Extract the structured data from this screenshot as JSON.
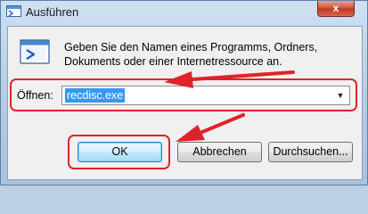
{
  "window": {
    "title": "Ausführen",
    "close_label": "x",
    "title_icon": "run-dialog-icon"
  },
  "dialog": {
    "description": "Geben Sie den Namen eines Programms, Ordners, Dokuments oder einer Internetressource an.",
    "big_icon": "run-dialog-icon",
    "open_label": "Öffnen:",
    "input_value": "recdisc.exe",
    "dropdown_icon": "chevron-down-icon"
  },
  "buttons": {
    "ok": "OK",
    "cancel": "Abbrechen",
    "browse": "Durchsuchen..."
  },
  "annotations": {
    "highlight_color": "#e0232a",
    "arrow_color": "#e0232a"
  }
}
